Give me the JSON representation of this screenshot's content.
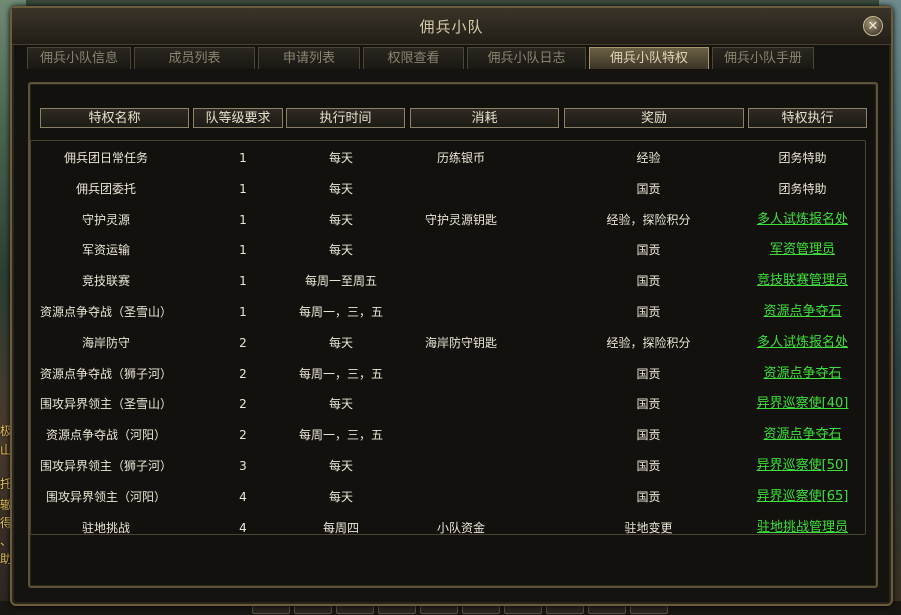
{
  "window": {
    "title": "佣兵小队"
  },
  "tabs": [
    {
      "label": "佣兵小队信息"
    },
    {
      "label": "成员列表"
    },
    {
      "label": "申请列表"
    },
    {
      "label": "权限查看"
    },
    {
      "label": "佣兵小队日志"
    },
    {
      "label": "佣兵小队特权",
      "active": true
    },
    {
      "label": "佣兵小队手册"
    }
  ],
  "columns": [
    "特权名称",
    "队等级要求",
    "执行时间",
    "消耗",
    "奖励",
    "特权执行"
  ],
  "rows": [
    {
      "name": "佣兵团日常任务",
      "level": "1",
      "time": "每天",
      "cost": "历练银币",
      "reward": "经验",
      "action": "团务特助",
      "action_link": false
    },
    {
      "name": "佣兵团委托",
      "level": "1",
      "time": "每天",
      "cost": "",
      "reward": "国贡",
      "action": "团务特助",
      "action_link": false
    },
    {
      "name": "守护灵源",
      "level": "1",
      "time": "每天",
      "cost": "守护灵源钥匙",
      "reward": "经验，探险积分",
      "action": "多人试炼报名处",
      "action_link": true
    },
    {
      "name": "军资运输",
      "level": "1",
      "time": "每天",
      "cost": "",
      "reward": "国贡",
      "action": "军资管理员",
      "action_link": true
    },
    {
      "name": "竞技联赛",
      "level": "1",
      "time": "每周一至周五",
      "cost": "",
      "reward": "国贡",
      "action": "竞技联赛管理员",
      "action_link": true
    },
    {
      "name": "资源点争夺战（圣雪山）",
      "level": "1",
      "time": "每周一，三，五",
      "cost": "",
      "reward": "国贡",
      "action": "资源点争夺石",
      "action_link": true
    },
    {
      "name": "海岸防守",
      "level": "2",
      "time": "每天",
      "cost": "海岸防守钥匙",
      "reward": "经验，探险积分",
      "action": "多人试炼报名处",
      "action_link": true
    },
    {
      "name": "资源点争夺战（狮子河）",
      "level": "2",
      "time": "每周一，三，五",
      "cost": "",
      "reward": "国贡",
      "action": "资源点争夺石",
      "action_link": true
    },
    {
      "name": "围攻异界领主（圣雪山）",
      "level": "2",
      "time": "每天",
      "cost": "",
      "reward": "国贡",
      "action": "异界巡察使[40]",
      "action_link": true
    },
    {
      "name": "资源点争夺战（河阳）",
      "level": "2",
      "time": "每周一，三，五",
      "cost": "",
      "reward": "国贡",
      "action": "资源点争夺石",
      "action_link": true
    },
    {
      "name": "围攻异界领主（狮子河）",
      "level": "3",
      "time": "每天",
      "cost": "",
      "reward": "国贡",
      "action": "异界巡察使[50]",
      "action_link": true
    },
    {
      "name": "围攻异界领主（河阳）",
      "level": "4",
      "time": "每天",
      "cost": "",
      "reward": "国贡",
      "action": "异界巡察使[65]",
      "action_link": true
    },
    {
      "name": "驻地挑战",
      "level": "4",
      "time": "每周四",
      "cost": "小队资金",
      "reward": "驻地变更",
      "action": "驻地挑战管理员",
      "action_link": true
    }
  ],
  "background_fragments": [
    "极",
    "山力",
    "托",
    "辙",
    "得最",
    "、死",
    "助胜"
  ],
  "colors": {
    "link": "#3ee03a",
    "text": "#ece6d6",
    "active_tab": "#6b6046"
  },
  "icons": {
    "close": "close-icon"
  }
}
